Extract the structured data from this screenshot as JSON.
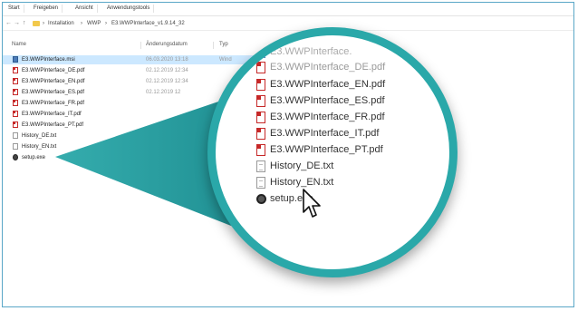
{
  "ribbon": {
    "tabs": [
      "Start",
      "Freigeben",
      "Ansicht",
      "Anwendungstools"
    ]
  },
  "address": {
    "back": "←",
    "forward": "→",
    "up": "↑",
    "crumbs": [
      "›",
      "Installation",
      "›",
      "WWP",
      "›",
      "E3.WWPInterface_v1.9.14_32"
    ]
  },
  "columns": {
    "name": "Name",
    "date": "Änderungsdatum",
    "type": "Typ"
  },
  "files": [
    {
      "name": "E3.WWPInterface.msi",
      "date": "06.03.2020 13:18",
      "type": "Wind",
      "icon": "msi-icon",
      "selected": true
    },
    {
      "name": "E3.WWPInterface_DE.pdf",
      "date": "02.12.2019 12:34",
      "type": "",
      "icon": "pdf-icon",
      "selected": false
    },
    {
      "name": "E3.WWPInterface_EN.pdf",
      "date": "02.12.2019 12:34",
      "type": "",
      "icon": "pdf-icon",
      "selected": false
    },
    {
      "name": "E3.WWPInterface_ES.pdf",
      "date": "02.12.2019 12",
      "type": "",
      "icon": "pdf-icon",
      "selected": false
    },
    {
      "name": "E3.WWPInterface_FR.pdf",
      "date": "",
      "type": "",
      "icon": "pdf-icon",
      "selected": false
    },
    {
      "name": "E3.WWPInterface_IT.pdf",
      "date": "",
      "type": "",
      "icon": "pdf-icon",
      "selected": false
    },
    {
      "name": "E3.WWPInterface_PT.pdf",
      "date": "",
      "type": "",
      "icon": "pdf-icon",
      "selected": false
    },
    {
      "name": "History_DE.txt",
      "date": "",
      "type": "",
      "icon": "txt-icon",
      "selected": false
    },
    {
      "name": "History_EN.txt",
      "date": "",
      "type": "",
      "icon": "txt-icon",
      "selected": false
    },
    {
      "name": "setup.exe",
      "date": "",
      "type": "",
      "icon": "exe-icon",
      "selected": false
    }
  ],
  "magnifier": {
    "items": [
      {
        "name": "E3.WWPInterface.",
        "icon": "msi-icon"
      },
      {
        "name": "E3.WWPInterface_DE.pdf",
        "icon": "pdf-icon"
      },
      {
        "name": "E3.WWPInterface_EN.pdf",
        "icon": "pdf-icon"
      },
      {
        "name": "E3.WWPInterface_ES.pdf",
        "icon": "pdf-icon"
      },
      {
        "name": "E3.WWPInterface_FR.pdf",
        "icon": "pdf-icon"
      },
      {
        "name": "E3.WWPInterface_IT.pdf",
        "icon": "pdf-icon"
      },
      {
        "name": "E3.WWPInterface_PT.pdf",
        "icon": "pdf-icon"
      },
      {
        "name": "History_DE.txt",
        "icon": "txt-icon"
      },
      {
        "name": "History_EN.txt",
        "icon": "txt-icon"
      },
      {
        "name": "setup.exe",
        "icon": "exe-icon"
      }
    ]
  },
  "colors": {
    "accent": "#2aa8a9",
    "selection": "#cce8ff",
    "pdf": "#c62828"
  }
}
